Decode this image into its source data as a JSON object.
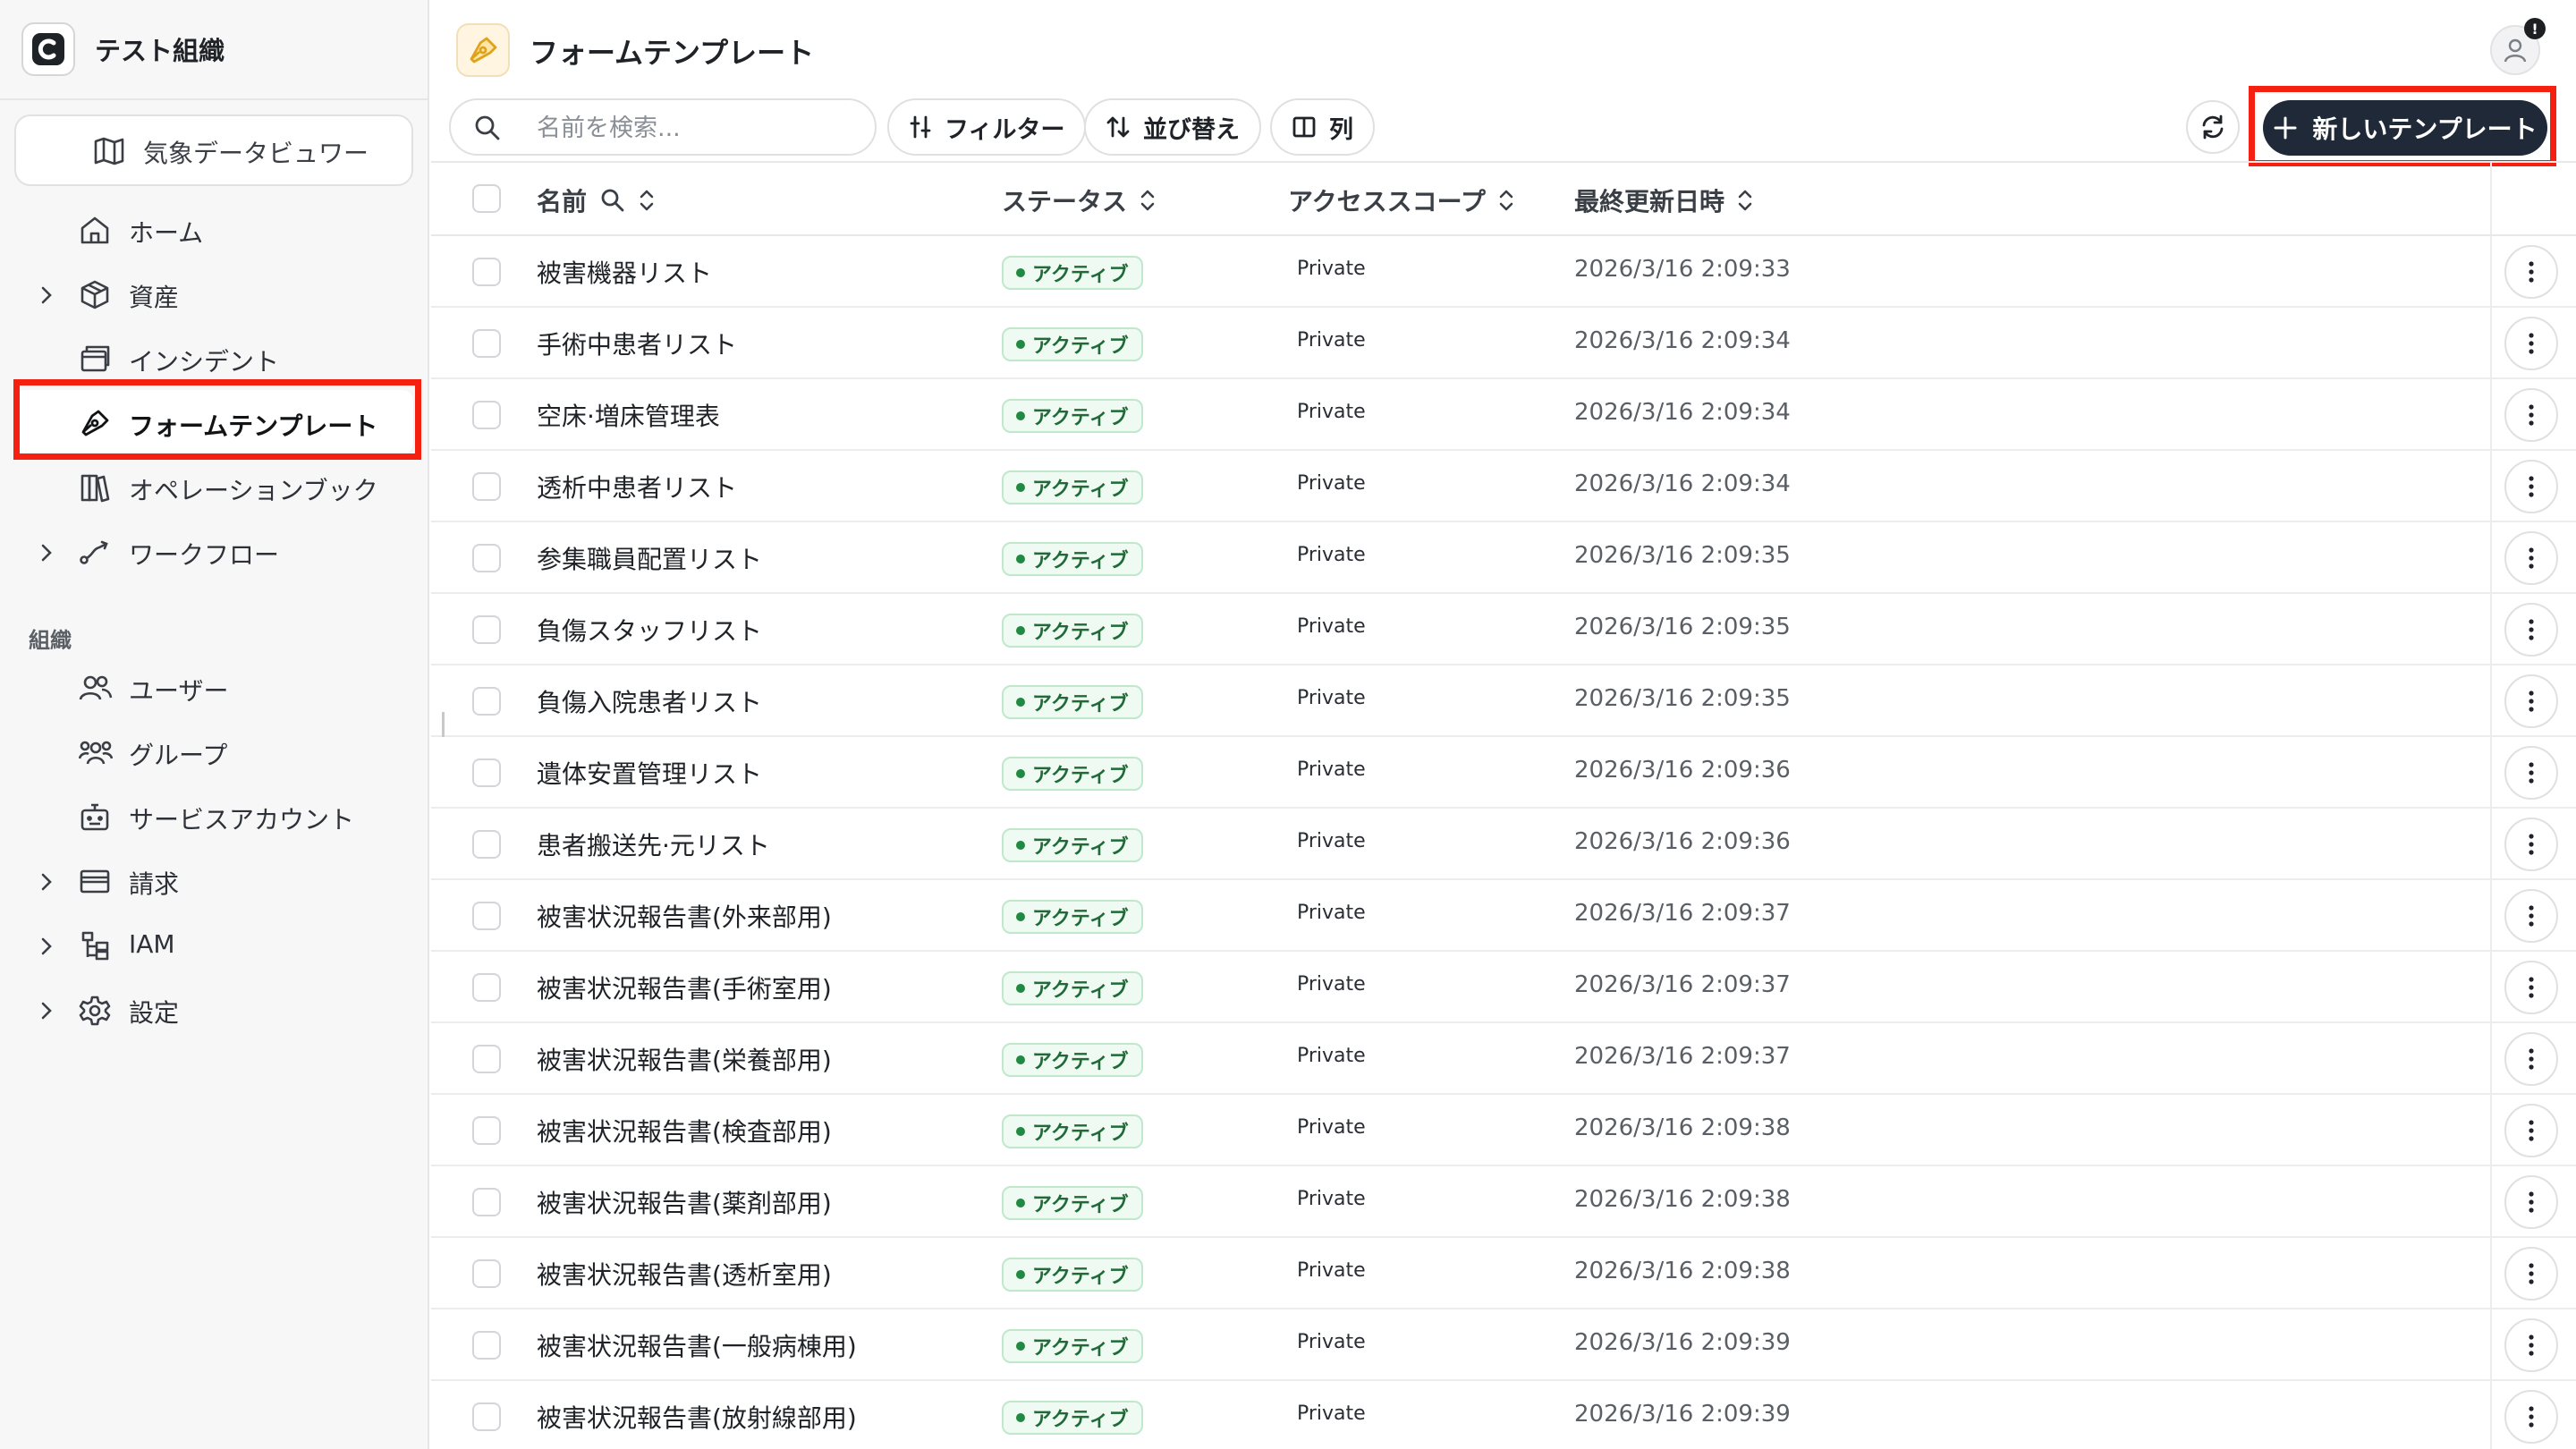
{
  "org": {
    "name": "テスト組織"
  },
  "app_switcher": {
    "label": "気象データビュワー",
    "icon": "map-icon"
  },
  "sidebar": {
    "items": [
      {
        "label": "ホーム",
        "icon": "home-icon",
        "expandable": false
      },
      {
        "label": "資産",
        "icon": "box-icon",
        "expandable": true
      },
      {
        "label": "インシデント",
        "icon": "window-icon",
        "expandable": false
      },
      {
        "label": "フォームテンプレート",
        "icon": "pen-icon",
        "expandable": false,
        "active": true
      },
      {
        "label": "オペレーションブック",
        "icon": "books-icon",
        "expandable": false
      },
      {
        "label": "ワークフロー",
        "icon": "workflow-icon",
        "expandable": true
      }
    ],
    "section_label": "組織",
    "org_items": [
      {
        "label": "ユーザー",
        "icon": "users-icon",
        "expandable": false
      },
      {
        "label": "グループ",
        "icon": "group-icon",
        "expandable": false
      },
      {
        "label": "サービスアカウント",
        "icon": "bot-icon",
        "expandable": false
      },
      {
        "label": "請求",
        "icon": "wallet-icon",
        "expandable": true
      },
      {
        "label": "IAM",
        "icon": "iam-icon",
        "expandable": true
      },
      {
        "label": "設定",
        "icon": "gear-icon",
        "expandable": true
      }
    ]
  },
  "header": {
    "title": "フォームテンプレート",
    "notification_count": "!"
  },
  "toolbar": {
    "search_placeholder": "名前を検索...",
    "filter_label": "フィルター",
    "sort_label": "並び替え",
    "columns_label": "列",
    "new_template_label": "新しいテンプレート"
  },
  "table": {
    "columns": {
      "name": "名前",
      "status": "ステータス",
      "scope": "アクセススコープ",
      "updated": "最終更新日時"
    },
    "rows": [
      {
        "name": "被害機器リスト",
        "status": "アクティブ",
        "scope": "Private",
        "updated": "2026/3/16 2:09:33"
      },
      {
        "name": "手術中患者リスト",
        "status": "アクティブ",
        "scope": "Private",
        "updated": "2026/3/16 2:09:34"
      },
      {
        "name": "空床·増床管理表",
        "status": "アクティブ",
        "scope": "Private",
        "updated": "2026/3/16 2:09:34"
      },
      {
        "name": "透析中患者リスト",
        "status": "アクティブ",
        "scope": "Private",
        "updated": "2026/3/16 2:09:34"
      },
      {
        "name": "参集職員配置リスト",
        "status": "アクティブ",
        "scope": "Private",
        "updated": "2026/3/16 2:09:35"
      },
      {
        "name": "負傷スタッフリスト",
        "status": "アクティブ",
        "scope": "Private",
        "updated": "2026/3/16 2:09:35"
      },
      {
        "name": "負傷入院患者リスト",
        "status": "アクティブ",
        "scope": "Private",
        "updated": "2026/3/16 2:09:35"
      },
      {
        "name": "遺体安置管理リスト",
        "status": "アクティブ",
        "scope": "Private",
        "updated": "2026/3/16 2:09:36"
      },
      {
        "name": "患者搬送先·元リスト",
        "status": "アクティブ",
        "scope": "Private",
        "updated": "2026/3/16 2:09:36"
      },
      {
        "name": "被害状況報告書(外来部用)",
        "status": "アクティブ",
        "scope": "Private",
        "updated": "2026/3/16 2:09:37"
      },
      {
        "name": "被害状況報告書(手術室用)",
        "status": "アクティブ",
        "scope": "Private",
        "updated": "2026/3/16 2:09:37"
      },
      {
        "name": "被害状況報告書(栄養部用)",
        "status": "アクティブ",
        "scope": "Private",
        "updated": "2026/3/16 2:09:37"
      },
      {
        "name": "被害状況報告書(検査部用)",
        "status": "アクティブ",
        "scope": "Private",
        "updated": "2026/3/16 2:09:38"
      },
      {
        "name": "被害状況報告書(薬剤部用)",
        "status": "アクティブ",
        "scope": "Private",
        "updated": "2026/3/16 2:09:38"
      },
      {
        "name": "被害状況報告書(透析室用)",
        "status": "アクティブ",
        "scope": "Private",
        "updated": "2026/3/16 2:09:38"
      },
      {
        "name": "被害状況報告書(一般病棟用)",
        "status": "アクティブ",
        "scope": "Private",
        "updated": "2026/3/16 2:09:39"
      },
      {
        "name": "被害状況報告書(放射線部用)",
        "status": "アクティブ",
        "scope": "Private",
        "updated": "2026/3/16 2:09:39"
      }
    ]
  },
  "colors": {
    "highlight": "#f5200f",
    "primary_button": "#1f2937",
    "badge_green": "#1f8a44"
  }
}
